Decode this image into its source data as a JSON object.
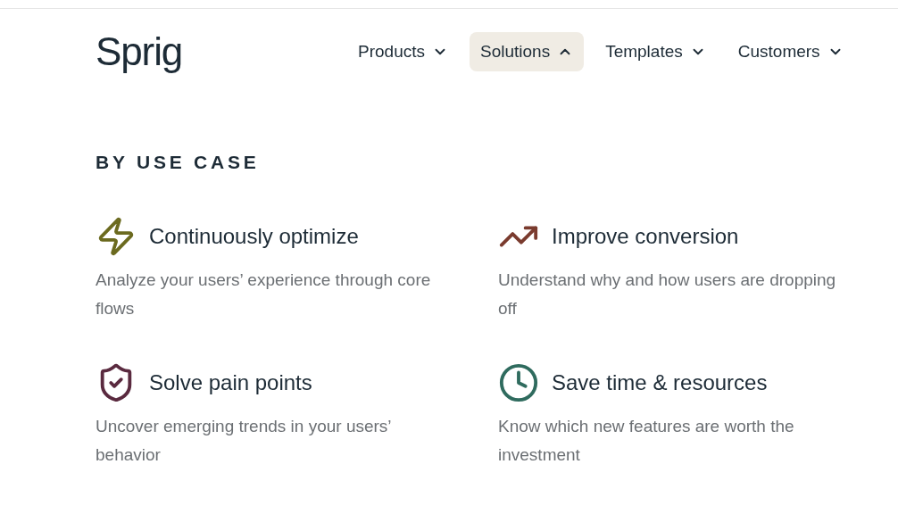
{
  "logo": "Sprig",
  "nav": [
    {
      "label": "Products",
      "selected": false
    },
    {
      "label": "Solutions",
      "selected": true
    },
    {
      "label": "Templates",
      "selected": false
    },
    {
      "label": "Customers",
      "selected": false
    }
  ],
  "section": {
    "heading": "BY USE CASE",
    "cards": [
      {
        "kind": "bolt",
        "title": "Continuously optimize",
        "description": "Analyze your users’ experience through core flows"
      },
      {
        "kind": "trend",
        "title": "Improve conversion",
        "description": "Understand why and how users are dropping off"
      },
      {
        "kind": "shield",
        "title": "Solve pain points",
        "description": "Uncover emerging trends in your users’ behavior"
      },
      {
        "kind": "clock",
        "title": "Save time & resources",
        "description": "Know which new features are worth the investment"
      }
    ]
  }
}
